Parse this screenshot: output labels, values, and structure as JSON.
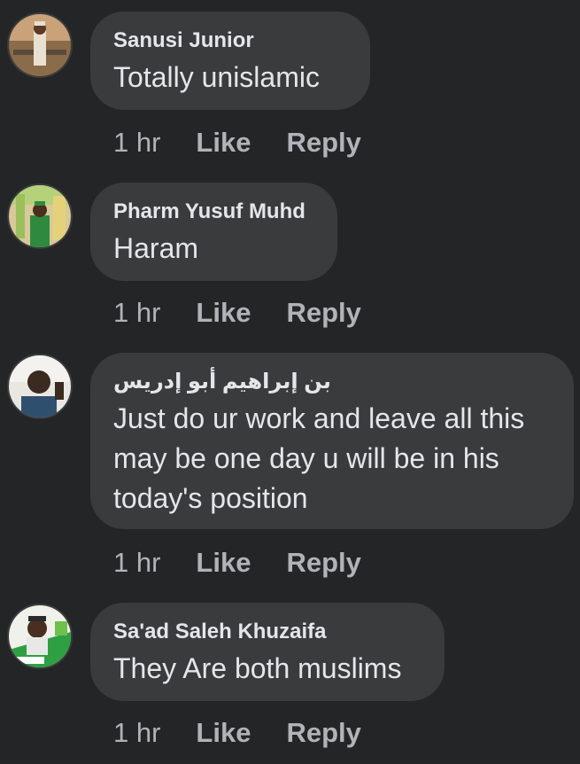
{
  "colors": {
    "background": "#242526",
    "bubble": "#3a3b3c",
    "primary_text": "#e4e6eb",
    "secondary_text": "#b0b3b8"
  },
  "comments": [
    {
      "author": "Sanusi Junior",
      "text": "Totally unislamic",
      "time": "1 hr",
      "like_label": "Like",
      "reply_label": "Reply"
    },
    {
      "author": "Pharm Yusuf Muhd",
      "text": "Haram",
      "time": "1 hr",
      "like_label": "Like",
      "reply_label": "Reply"
    },
    {
      "author": "بن إبراهيم أبو إدريس",
      "text": "Just do ur work and leave all this may be one day u will be in his today's position",
      "time": "1 hr",
      "like_label": "Like",
      "reply_label": "Reply"
    },
    {
      "author": "Sa'ad Saleh Khuzaifa",
      "text": "They Are both muslims",
      "time": "1 hr",
      "like_label": "Like",
      "reply_label": "Reply"
    }
  ]
}
